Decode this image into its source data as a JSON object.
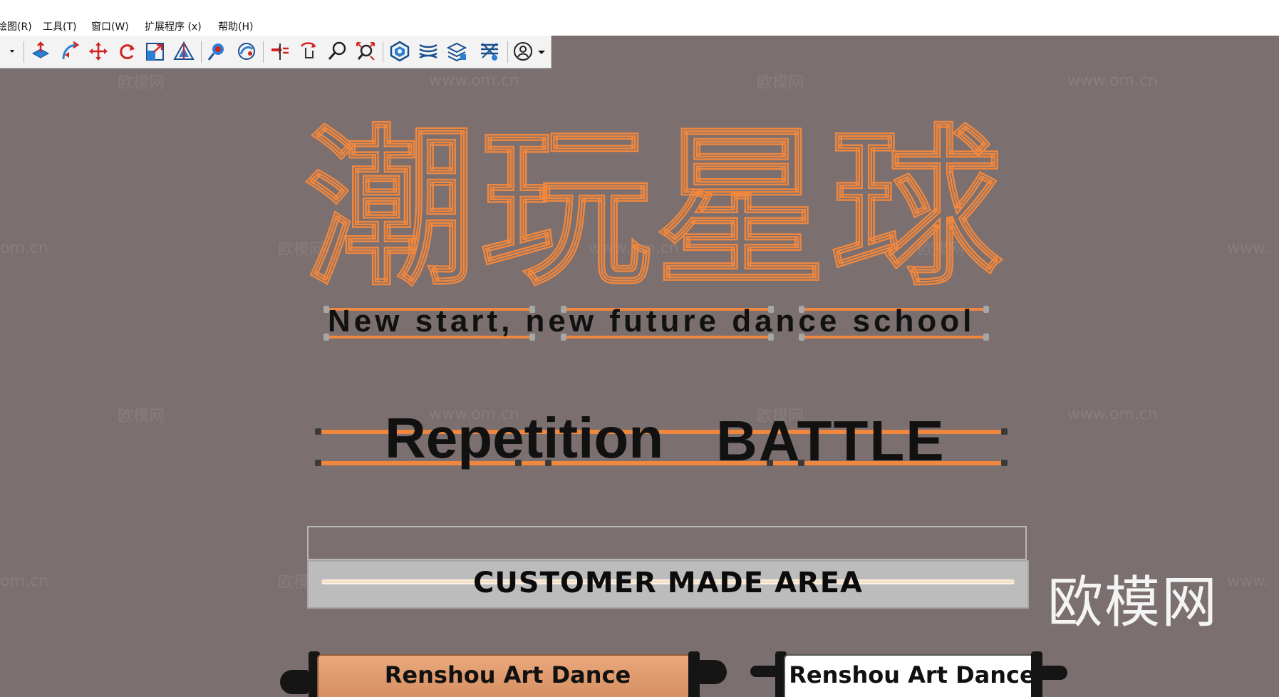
{
  "menubar": {
    "items": [
      "绘图(R)",
      "工具(T)",
      "窗口(W)",
      "扩展程序 (x)",
      "帮助(H)"
    ]
  },
  "toolbar": {
    "icons": [
      "select-arrow-icon",
      "push-pull-icon",
      "follow-me-icon",
      "move-icon",
      "rotate-icon",
      "scale-icon",
      "offset-icon",
      "position-camera-icon",
      "look-around-icon",
      "walk-icon",
      "orbit-icon",
      "zoom-icon",
      "zoom-extents-icon",
      "sandbox-icon",
      "stamp-icon",
      "layers-icon",
      "styles-icon",
      "account-icon"
    ]
  },
  "watermarks": {
    "brand_cn": "欧模网",
    "site": "www.om.cn",
    "site_partial": "om.cn",
    "site_left": "www."
  },
  "canvas": {
    "title_cn": "潮玩星球",
    "subtitle": "New start, new future dance school",
    "repetition": "Repetition",
    "battle": "BATTLE",
    "customer_area": "CUSTOMER MADE AREA",
    "scroll_left": "Renshou Art Dance",
    "scroll_right": "Renshou Art Dance",
    "brand_watermark": "欧模网"
  },
  "colors": {
    "canvas_bg": "#7b6f6f",
    "accent_orange": "#f0873e",
    "scroll_copper": "#d8946a",
    "text_dark": "#111111"
  }
}
